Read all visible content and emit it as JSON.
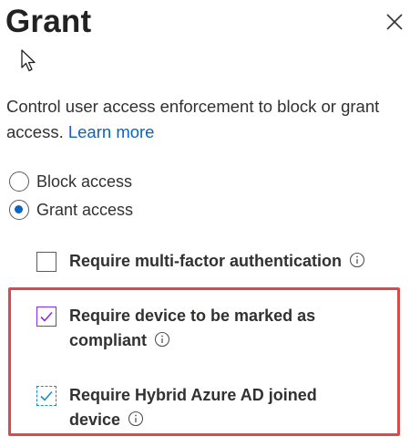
{
  "panel": {
    "title": "Grant",
    "close_icon": "close-icon",
    "description": "Control user access enforcement to block or grant access.",
    "learn_more": "Learn more"
  },
  "access_options": [
    {
      "label": "Block access",
      "selected": false
    },
    {
      "label": "Grant access",
      "selected": true
    }
  ],
  "requirements": [
    {
      "label": "Require multi-factor authentication",
      "checked": false
    },
    {
      "label": "Require device to be marked as compliant",
      "checked": true
    },
    {
      "label": "Require Hybrid Azure AD joined device",
      "checked": true
    }
  ],
  "colors": {
    "accent": "#0b64c4",
    "highlight_border": "#e04848",
    "checkbox_purple": "#8a2be2",
    "checkbox_blue": "#1a8cc4"
  }
}
